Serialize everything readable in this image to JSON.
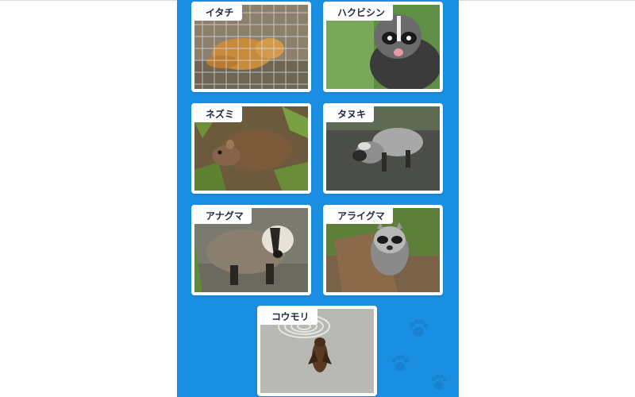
{
  "animals": [
    {
      "label": "イタチ",
      "photo": "weasel-in-cage-photo"
    },
    {
      "label": "ハクビシン",
      "photo": "masked-palm-civet-photo"
    },
    {
      "label": "ネズミ",
      "photo": "rat-photo"
    },
    {
      "label": "タヌキ",
      "photo": "raccoon-dog-photo"
    },
    {
      "label": "アナグマ",
      "photo": "badger-photo"
    },
    {
      "label": "アライグマ",
      "photo": "raccoon-photo"
    },
    {
      "label": "コウモリ",
      "photo": "bat-photo"
    }
  ],
  "colors": {
    "panel": "#1a8ee0",
    "card": "#ffffff",
    "label_text": "#1f2a44"
  }
}
